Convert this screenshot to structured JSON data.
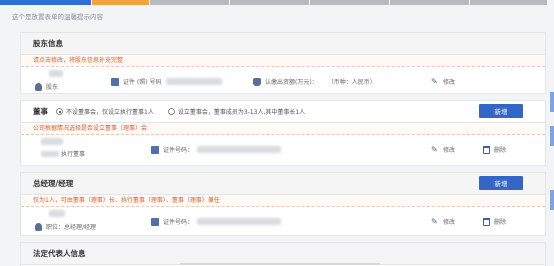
{
  "progress": {
    "segments": [
      {
        "color": "#2f6fd6",
        "width": 92
      },
      {
        "color": "#f2a33a",
        "width": 58
      },
      {
        "color": "#b7b9bd",
        "width": 80
      },
      {
        "color": "#b7b9bd",
        "width": 80
      },
      {
        "color": "#b7b9bd",
        "width": 80
      },
      {
        "color": "#b7b9bd",
        "width": 80
      },
      {
        "color": "#b7b9bd",
        "width": 78
      }
    ]
  },
  "hint": "这个是放置表单的温馨提示内容",
  "shareholder": {
    "title": "股东信息",
    "notice": "请点击修改，将股东信息补充完整",
    "role": "股东",
    "id_label": "证件 (照) 号码",
    "capital_label": "认缴出资额(万元)：",
    "currency": "（币种：人民币）",
    "edit": "修改"
  },
  "directors": {
    "title": "董事",
    "option_no_board": "不设董事会，仅设立执行董事1人",
    "option_board": "设立董事会，董事成员为3-13人,其中董事长1人",
    "add": "新增",
    "notice": "公司根据情况选择是否设立董事（理事）会",
    "role": "执行董事",
    "id_label": "证件号码：",
    "edit": "修改",
    "delete": "删除"
  },
  "manager": {
    "title": "总经理/经理",
    "add": "新增",
    "notice": "仅为1人，可由董事（理事）长、执行董事（理事）、董事（理事）兼任",
    "role": "职位：总经理/经理",
    "id_label": "证件号码：",
    "edit": "修改",
    "delete": "删除"
  },
  "legal_rep": {
    "title": "法定代表人信息"
  }
}
